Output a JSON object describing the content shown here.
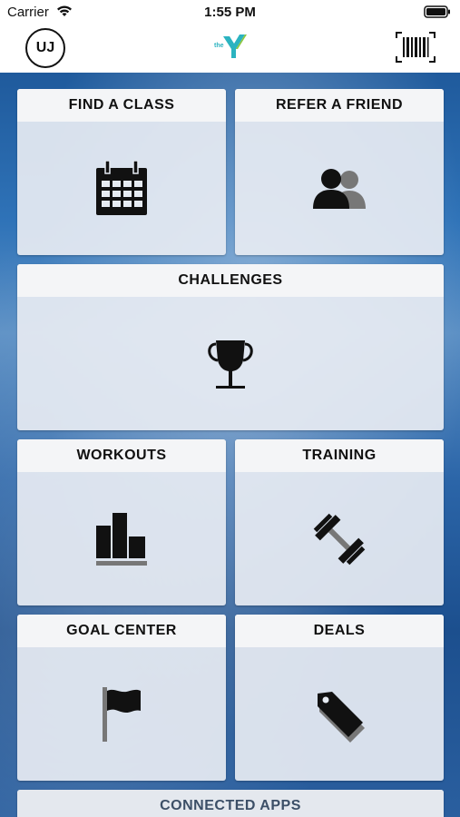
{
  "status_bar": {
    "carrier": "Carrier",
    "time": "1:55 PM"
  },
  "header": {
    "avatar_initials": "UJ",
    "logo_text": "the"
  },
  "tiles": [
    {
      "label": "FIND A CLASS",
      "icon": "calendar-icon"
    },
    {
      "label": "REFER A FRIEND",
      "icon": "people-icon"
    },
    {
      "label": "CHALLENGES",
      "icon": "trophy-icon"
    },
    {
      "label": "WORKOUTS",
      "icon": "bar-chart-icon"
    },
    {
      "label": "TRAINING",
      "icon": "dumbbell-icon"
    },
    {
      "label": "GOAL CENTER",
      "icon": "flag-icon"
    },
    {
      "label": "DEALS",
      "icon": "tag-icon"
    },
    {
      "label": "CONNECTED APPS",
      "icon": ""
    }
  ],
  "colors": {
    "brand_teal": "#2bb3c0",
    "brand_green": "#8dc63f",
    "background_blue": "#2b65a8"
  }
}
